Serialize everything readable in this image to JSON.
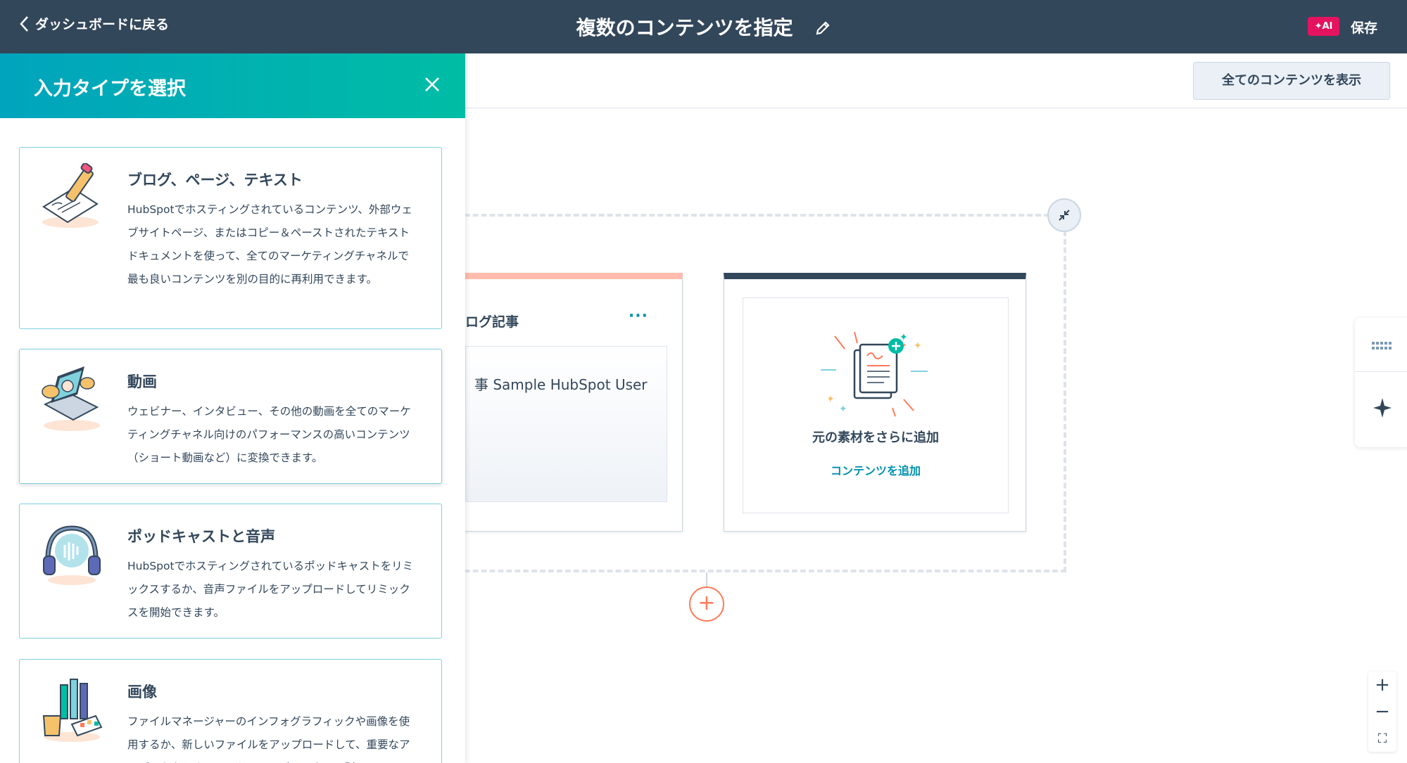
{
  "header": {
    "back_label": "ダッシュボードに戻る",
    "title": "複数のコンテンツを指定",
    "ai_badge": "✦AI",
    "save_label": "保存"
  },
  "toolbar": {
    "show_all_label": "全てのコンテンツを表示"
  },
  "panel": {
    "title": "入力タイプを選択",
    "options": [
      {
        "title": "ブログ、ページ、テキスト",
        "description": "HubSpotでホスティングされているコンテンツ、外部ウェブサイトページ、またはコピー＆ペーストされたテキストドキュメントを使って、全てのマーケティングチャネルで最も良いコンテンツを別の目的に再利用できます。",
        "icon": "writing-pencil-icon"
      },
      {
        "title": "動画",
        "description": "ウェビナー、インタビュー、その他の動画を全てのマーケティングチャネル向けのパフォーマンスの高いコンテンツ（ショート動画など）に変換できます。",
        "icon": "laptop-video-icon"
      },
      {
        "title": "ポッドキャストと音声",
        "description": "HubSpotでホスティングされているポッドキャストをリミックスするか、音声ファイルをアップロードしてリミックスを開始できます。",
        "icon": "headphones-icon"
      },
      {
        "title": "画像",
        "description": "ファイルマネージャーのインフォグラフィックや画像を使用するか、新しいファイルをアップロードして、重要なアイデアをあらゆるマーケティングチャネルで別の",
        "icon": "art-supplies-icon"
      }
    ]
  },
  "canvas": {
    "blog_card": {
      "title": "ログ記事",
      "more_label": "···",
      "author": "事 Sample HubSpot User"
    },
    "add_card": {
      "title": "元の素材をさらに追加",
      "link_label": "コンテンツを追加"
    },
    "add_step_label": "+"
  },
  "zoom": {
    "in": "+",
    "out": "−",
    "fit": "⛶"
  },
  "colors": {
    "header": "#33475b",
    "panel_gradient_start": "#00a4bd",
    "panel_gradient_end": "#00bda5",
    "ai_badge": "#e5135f",
    "accent_link": "#0091ae",
    "blog_accent": "#ffbcac",
    "add_button": "#ff7a59"
  }
}
